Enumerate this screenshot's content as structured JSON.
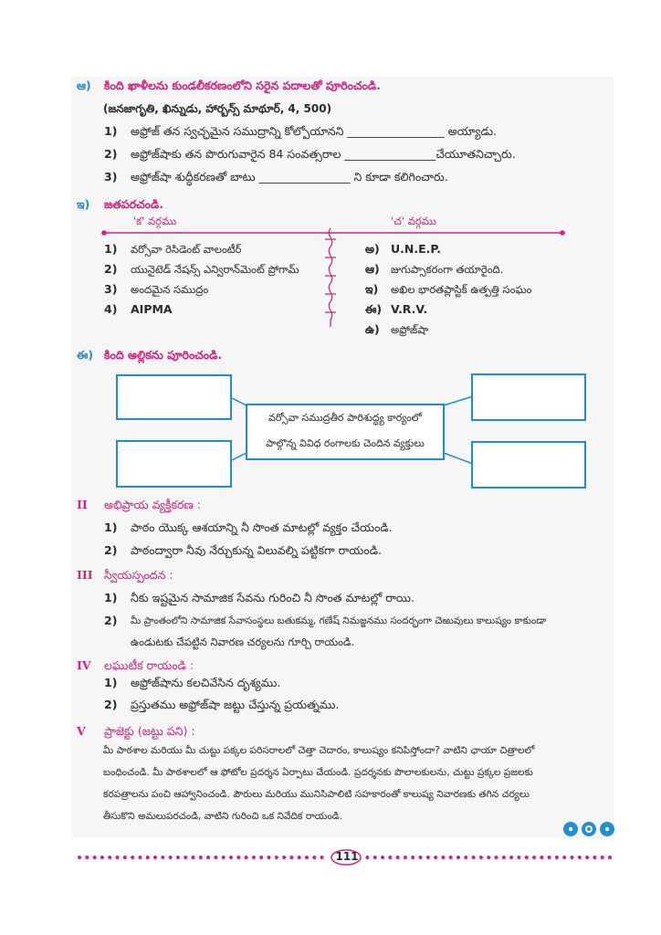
{
  "sec_aa": {
    "marker": "ఆ)",
    "title": "కింది ఖాళీలను కుండలీకరణంలోని సరైన పదాలతో పూరించండి.",
    "words": "(జనజాగృతి, ఖిన్నుడు, హార్బన్స్ మాథూర్, 4, 500)",
    "items": [
      {
        "no": "1)",
        "text": "అఫ్రోజ్ తన స్వచ్ఛమైన సముద్రాన్ని కోల్పోయానని _________________ అయ్యాడు."
      },
      {
        "no": "2)",
        "text": "అఫ్రోజ్‌షాకు తన పొరుగువారైన 84 సంవత్సరాల ________________చేయూతనిచ్చారు."
      },
      {
        "no": "3)",
        "text": "అఫ్రోజ్‌షా శుద్ధీకరణతో బాటు ________________ ని కూడా కలిగించారు."
      }
    ]
  },
  "sec_i": {
    "marker": "ఇ)",
    "title": "జతపరచండి.",
    "col_a": "'క' వర్గము",
    "col_b": "'చ' వర్గము",
    "left": [
      {
        "no": "1)",
        "text": "వర్సోవా రెసిడెంట్ వాలంటీర్"
      },
      {
        "no": "2)",
        "text": "యునైటెడ్ నేషన్స్ ఎన్విరాన్‌మెంట్ ప్రోగామ్"
      },
      {
        "no": "3)",
        "text": "అందమైన సముద్రం"
      },
      {
        "no": "4)",
        "text": "AIPMA"
      }
    ],
    "right": [
      {
        "no": "అ)",
        "text": "U.N.E.P."
      },
      {
        "no": "ఆ)",
        "text": "జుగుప్సాకరంగా తయారైంది."
      },
      {
        "no": "ఇ)",
        "text": "అఖిల భారతప్లాస్టిక్ ఉత్పత్తి సంఘం"
      },
      {
        "no": "ఈ)",
        "text": "V.R.V."
      },
      {
        "no": "ఉ)",
        "text": "అఫ్రోజ్‌షా"
      }
    ]
  },
  "sec_ii": {
    "marker": "ఈ)",
    "title": "కింది అల్లికను పూరించండి.",
    "center_line1": "వర్సోవా సముద్రతీర పారిశుద్ధ్య కార్యంలో",
    "center_line2": "పాల్గొన్న వివిధ రంగాలకు చెందిన వ్యక్తులు"
  },
  "sec_II": {
    "marker": "II",
    "title": "అభిప్రాయ వ్యక్తీకరణ :",
    "items": [
      {
        "no": "1)",
        "text": "పాఠం యొక్క ఆశయాన్ని నీ సొంత మాటల్లో వ్యక్తం చేయండి."
      },
      {
        "no": "2)",
        "text": "పాఠంద్వారా నీవు నేర్చుకున్న విలువల్ని పట్టికగా రాయండి."
      }
    ]
  },
  "sec_III": {
    "marker": "III",
    "title": "స్వీయస్పందన :",
    "items": [
      {
        "no": "1)",
        "text": "నీకు ఇష్టమైన సామాజిక సేవను గురించి నీ సొంత మాటల్లో రాయి."
      },
      {
        "no": "2)",
        "text": "మీ ప్రాంతంలోని సామాజిక సేవాసంస్థలు బతుకమ్మ, గణేష్ నిమజ్జనము సందర్భంగా చెఱువులు కాలుష్యం కాకుండా"
      },
      {
        "no": "",
        "text": "ఉండుటకు చేపట్టిన నివారణ చర్యలను గూర్చి రాయండి."
      }
    ]
  },
  "sec_IV": {
    "marker": "IV",
    "title": "లఘుటీక రాయండి :",
    "items": [
      {
        "no": "1)",
        "text": "అఫ్రోజ్‌షాను కలచివేసిన దృశ్యము."
      },
      {
        "no": "2)",
        "text": "ప్రస్తుతము అఫ్రోజ్‌షా జట్టు చేస్తున్న ప్రయత్నము."
      }
    ]
  },
  "sec_V": {
    "marker": "V",
    "title": "ప్రాజెక్టు (జట్టు పని) :",
    "lines": [
      "మీ పాఠశాల మరియు మీ చుట్టు పక్కల పరిసరాలలో చెత్తా చెదారం, కాలుష్యం కనిపిస్తోందా? వాటిని ఛాయా చిత్రాలలో",
      "బంధించండి. మీ పాఠశాలలో ఆ ఫోటోల ప్రదర్శన ఏర్పాటు చేయండి. ప్రదర్శనకు పొలాలకులను, చుట్టు ప్రక్కల ప్రజలకు",
      "కరపత్రాలను పంచి ఆహ్వానించండి. పౌరులు మరియు మునిసిపాలిటి సహకారంతో కాలుష్య నివారణకు తగిన చర్యలు",
      "తీసుకొని అమలుపరచండి, వాటిని గురించి ఒక నివేదిక రాయండి."
    ]
  },
  "page_number": "111",
  "colors": {
    "magenta": "#d81f7f",
    "blue": "#2a8cd0",
    "box_border": "#1e8fd0"
  }
}
